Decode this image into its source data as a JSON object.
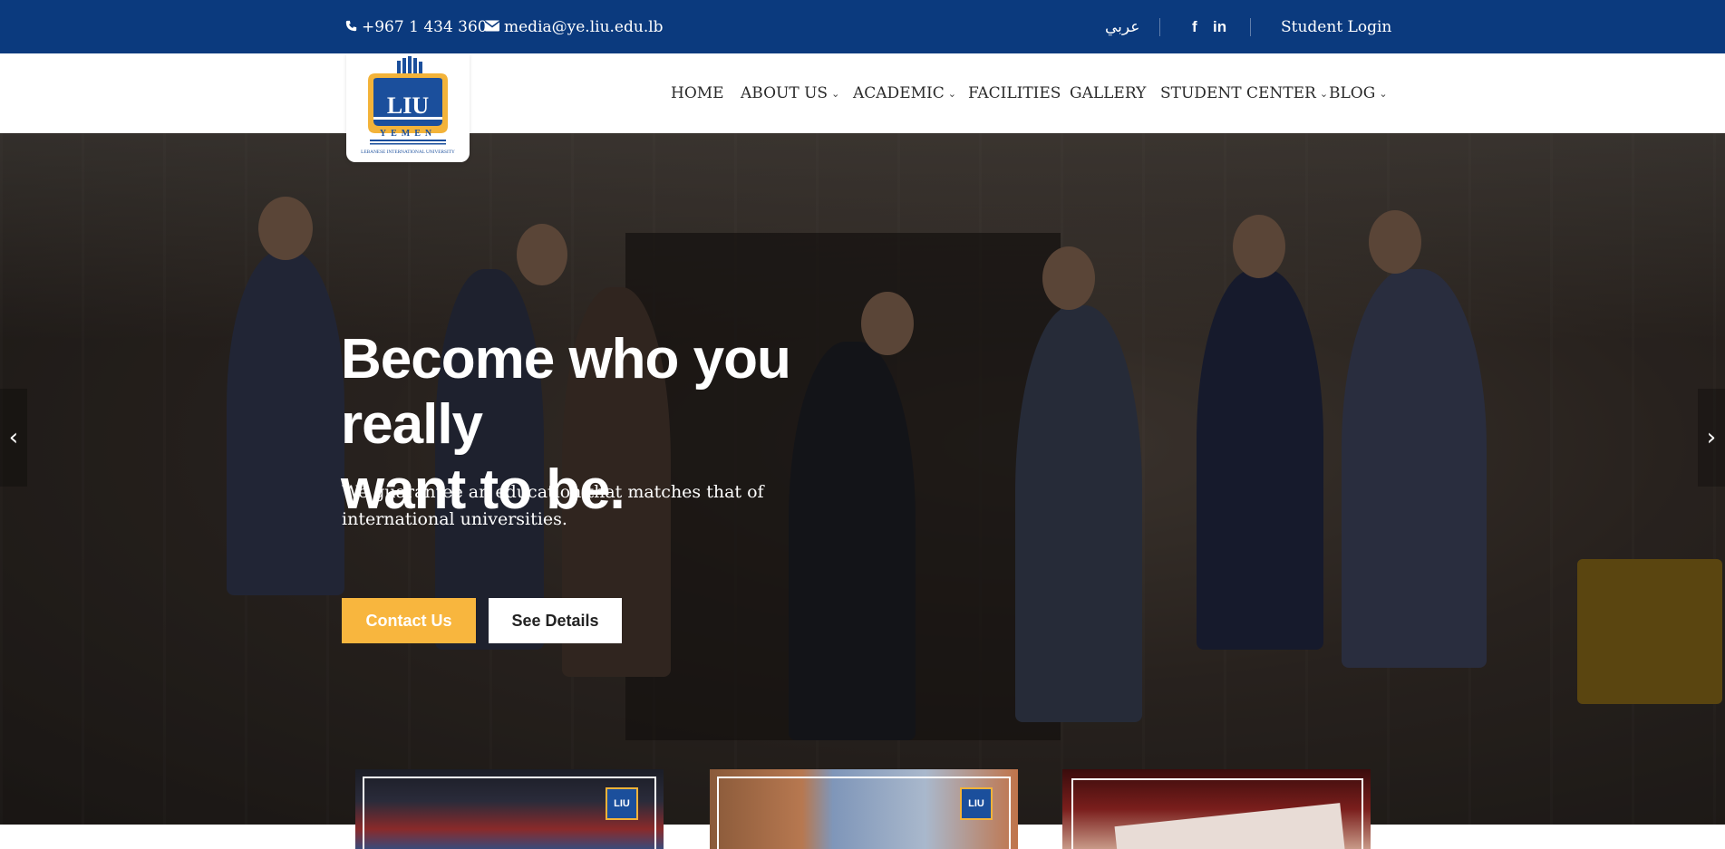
{
  "topbar": {
    "phone": "+967 1 434 360",
    "email": "media@ye.liu.edu.lb",
    "language": "عربي",
    "social": [
      {
        "name": "facebook-icon",
        "glyph": "f"
      },
      {
        "name": "linkedin-icon",
        "glyph": "in"
      }
    ],
    "login": "Student Login"
  },
  "logo": {
    "brand": "LIU",
    "country": "YEMEN",
    "tagline": "LEBANESE INTERNATIONAL UNIVERSITY",
    "colors": {
      "blue": "#1b4f9c",
      "gold": "#f3b339"
    }
  },
  "nav": {
    "items": [
      {
        "label": "HOME",
        "has_dropdown": false
      },
      {
        "label": "ABOUT US",
        "has_dropdown": true
      },
      {
        "label": "ACADEMIC",
        "has_dropdown": true
      },
      {
        "label": "FACILITIES",
        "has_dropdown": false
      },
      {
        "label": "GALLERY",
        "has_dropdown": false
      },
      {
        "label": "STUDENT CENTER",
        "has_dropdown": true
      },
      {
        "label": "BLOG",
        "has_dropdown": true
      }
    ]
  },
  "hero": {
    "title_line1": "Become who you really",
    "title_line2": "want to be.",
    "subtitle_line1": "We guarantee an education that matches that of",
    "subtitle_line2": "international universities.",
    "contact_button": "Contact Us",
    "details_button": "See Details",
    "prev_icon": "chevron-left-icon",
    "next_icon": "chevron-right-icon"
  },
  "colors": {
    "topbar": "#0b3a7e",
    "accent": "#f8b63e"
  },
  "cards": [
    {
      "logo": "LIU"
    },
    {
      "logo": "LIU"
    },
    {
      "logo": ""
    }
  ]
}
